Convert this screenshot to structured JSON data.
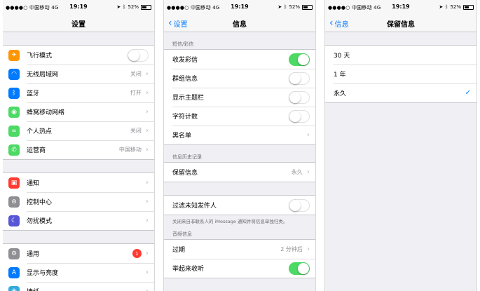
{
  "status": {
    "carrier": "●●●●○ 中国移动",
    "network": "4G",
    "time": "19:19",
    "battery_pct": "52%",
    "battery_level": 0.52
  },
  "settings": {
    "title": "设置",
    "group1": [
      {
        "icon": "airplane-icon",
        "glyph": "✈",
        "color": "#ff9500",
        "label": "飞行模式",
        "toggle": false
      },
      {
        "icon": "wifi-icon",
        "glyph": "◠",
        "color": "#007aff",
        "label": "无线局域网",
        "value": "关闭"
      },
      {
        "icon": "bluetooth-icon",
        "glyph": "ᛒ",
        "color": "#007aff",
        "label": "蓝牙",
        "value": "打开"
      },
      {
        "icon": "cellular-icon",
        "glyph": "◉",
        "color": "#4cd964",
        "label": "蜂窝移动网络"
      },
      {
        "icon": "hotspot-icon",
        "glyph": "∞",
        "color": "#4cd964",
        "label": "个人热点",
        "value": "关闭"
      },
      {
        "icon": "carrier-phone-icon",
        "glyph": "✆",
        "color": "#4cd964",
        "label": "运营商",
        "value": "中国移动"
      }
    ],
    "group2": [
      {
        "icon": "notifications-icon",
        "glyph": "▣",
        "color": "#ff3b30",
        "label": "通知"
      },
      {
        "icon": "control-center-icon",
        "glyph": "⊜",
        "color": "#8e8e93",
        "label": "控制中心"
      },
      {
        "icon": "do-not-disturb-icon",
        "glyph": "☾",
        "color": "#5856d6",
        "label": "勿扰模式"
      }
    ],
    "group3": [
      {
        "icon": "general-gear-icon",
        "glyph": "⚙",
        "color": "#8e8e93",
        "label": "通用",
        "badge": "1"
      },
      {
        "icon": "display-brightness-icon",
        "glyph": "A",
        "color": "#007aff",
        "label": "显示与亮度"
      },
      {
        "icon": "wallpaper-icon",
        "glyph": "❀",
        "color": "#34aadc",
        "label": "墙纸"
      }
    ]
  },
  "messages": {
    "back": "设置",
    "title": "信息",
    "sms_header": "短信/彩信",
    "sms_rows": [
      {
        "label": "收发彩信",
        "toggle": true
      },
      {
        "label": "群组信息",
        "toggle": false
      },
      {
        "label": "显示主题栏",
        "toggle": false
      },
      {
        "label": "字符计数",
        "toggle": false
      },
      {
        "label": "黑名单",
        "chevron": true
      }
    ],
    "history_header": "信息历史记录",
    "keep": {
      "label": "保留信息",
      "value": "永久"
    },
    "filter": {
      "label": "过滤未知发件人",
      "toggle": false
    },
    "filter_footer": "关闭来自非联系人的 iMessage 通知并将信息单独归类。",
    "audio_header": "音频信息",
    "expire": {
      "label": "过期",
      "value": "2 分钟后"
    },
    "raise": {
      "label": "举起来收听",
      "toggle": true
    }
  },
  "keep_messages": {
    "back": "信息",
    "title": "保留信息",
    "options": [
      {
        "label": "30 天",
        "checked": false
      },
      {
        "label": "1 年",
        "checked": false
      },
      {
        "label": "永久",
        "checked": true
      }
    ]
  }
}
